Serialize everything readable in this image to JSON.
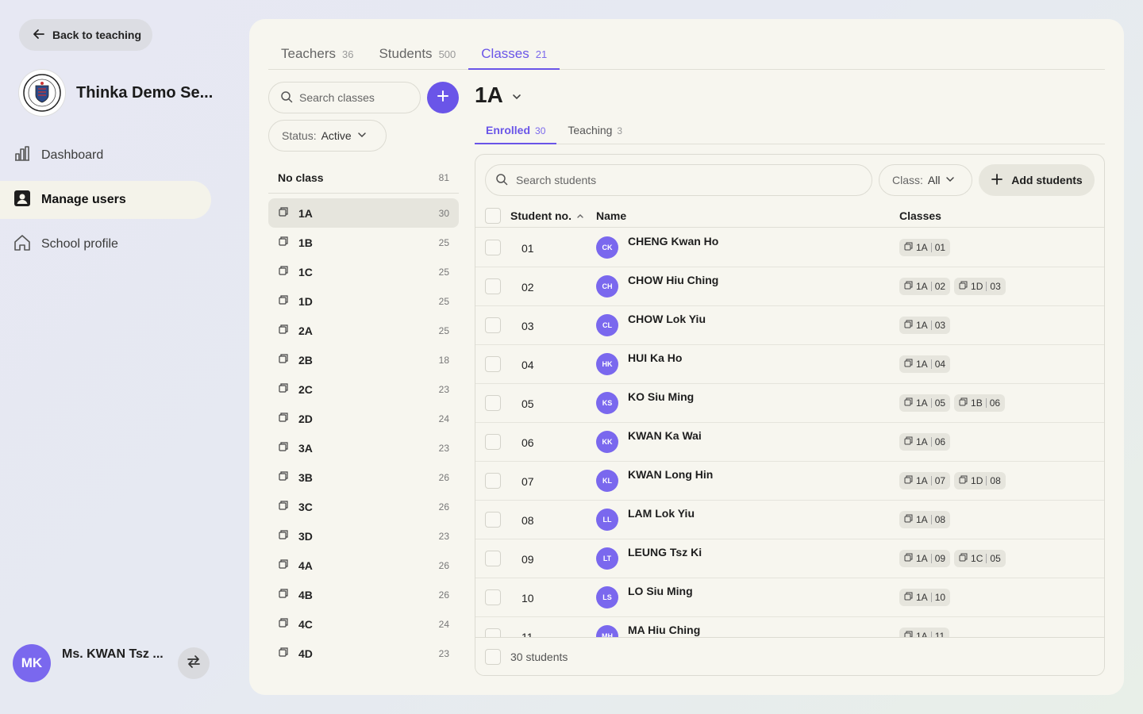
{
  "sidebar": {
    "back_label": "Back to teaching",
    "school_name": "Thinka Demo Se...",
    "nav": [
      {
        "label": "Dashboard",
        "icon": "bar-chart-icon"
      },
      {
        "label": "Manage users",
        "icon": "user-card-icon",
        "active": true
      },
      {
        "label": "School profile",
        "icon": "home-icon"
      }
    ],
    "user": {
      "initials": "MK",
      "name": "Ms. KWAN Tsz ..."
    }
  },
  "tabs": [
    {
      "label": "Teachers",
      "count": "36"
    },
    {
      "label": "Students",
      "count": "500"
    },
    {
      "label": "Classes",
      "count": "21",
      "active": true
    }
  ],
  "classes_panel": {
    "search_placeholder": "Search classes",
    "status_label": "Status:",
    "status_value": "Active",
    "no_class_label": "No class",
    "no_class_count": "81",
    "items": [
      {
        "name": "1A",
        "count": "30"
      },
      {
        "name": "1B",
        "count": "25"
      },
      {
        "name": "1C",
        "count": "25"
      },
      {
        "name": "1D",
        "count": "25"
      },
      {
        "name": "2A",
        "count": "25"
      },
      {
        "name": "2B",
        "count": "18"
      },
      {
        "name": "2C",
        "count": "23"
      },
      {
        "name": "2D",
        "count": "24"
      },
      {
        "name": "3A",
        "count": "23"
      },
      {
        "name": "3B",
        "count": "26"
      },
      {
        "name": "3C",
        "count": "26"
      },
      {
        "name": "3D",
        "count": "23"
      },
      {
        "name": "4A",
        "count": "26"
      },
      {
        "name": "4B",
        "count": "26"
      },
      {
        "name": "4C",
        "count": "24"
      },
      {
        "name": "4D",
        "count": "23"
      }
    ],
    "selected": "1A"
  },
  "detail": {
    "title": "1A",
    "subtabs": [
      {
        "label": "Enrolled",
        "count": "30",
        "active": true
      },
      {
        "label": "Teaching",
        "count": "3"
      }
    ],
    "search_placeholder": "Search students",
    "class_filter_label": "Class:",
    "class_filter_value": "All",
    "add_students_label": "Add students",
    "columns": {
      "no": "Student no.",
      "name": "Name",
      "classes": "Classes"
    },
    "rows": [
      {
        "no": "01",
        "initials": "CK",
        "name": "CHENG Kwan Ho",
        "classes": [
          [
            "1A",
            "01"
          ]
        ]
      },
      {
        "no": "02",
        "initials": "CH",
        "name": "CHOW Hiu Ching",
        "classes": [
          [
            "1A",
            "02"
          ],
          [
            "1D",
            "03"
          ]
        ]
      },
      {
        "no": "03",
        "initials": "CL",
        "name": "CHOW Lok Yiu",
        "classes": [
          [
            "1A",
            "03"
          ]
        ]
      },
      {
        "no": "04",
        "initials": "HK",
        "name": "HUI Ka Ho",
        "classes": [
          [
            "1A",
            "04"
          ]
        ]
      },
      {
        "no": "05",
        "initials": "KS",
        "name": "KO Siu Ming",
        "classes": [
          [
            "1A",
            "05"
          ],
          [
            "1B",
            "06"
          ]
        ]
      },
      {
        "no": "06",
        "initials": "KK",
        "name": "KWAN Ka Wai",
        "classes": [
          [
            "1A",
            "06"
          ]
        ]
      },
      {
        "no": "07",
        "initials": "KL",
        "name": "KWAN Long Hin",
        "classes": [
          [
            "1A",
            "07"
          ],
          [
            "1D",
            "08"
          ]
        ]
      },
      {
        "no": "08",
        "initials": "LL",
        "name": "LAM Lok Yiu",
        "classes": [
          [
            "1A",
            "08"
          ]
        ]
      },
      {
        "no": "09",
        "initials": "LT",
        "name": "LEUNG Tsz Ki",
        "classes": [
          [
            "1A",
            "09"
          ],
          [
            "1C",
            "05"
          ]
        ]
      },
      {
        "no": "10",
        "initials": "LS",
        "name": "LO Siu Ming",
        "classes": [
          [
            "1A",
            "10"
          ]
        ]
      },
      {
        "no": "11",
        "initials": "MH",
        "name": "MA Hiu Ching",
        "classes": [
          [
            "1A",
            "11"
          ]
        ]
      }
    ],
    "footer_label": "30 students"
  },
  "colors": {
    "accent": "#6a55e8",
    "avatar": "#7a68ee",
    "panel": "#f7f6ef"
  }
}
